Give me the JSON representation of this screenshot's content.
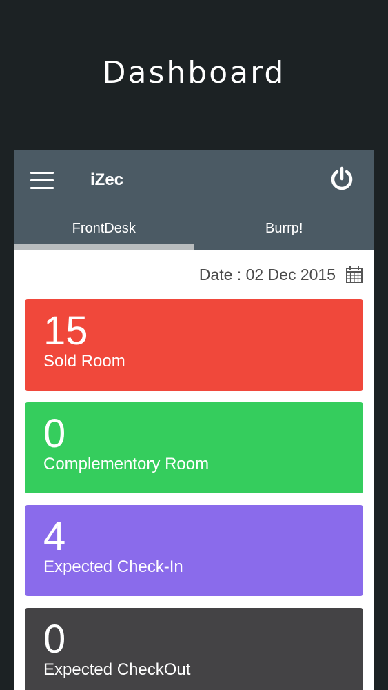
{
  "page": {
    "title": "Dashboard"
  },
  "appbar": {
    "title": "iZec",
    "menu_icon": "hamburger-menu-icon",
    "power_icon": "power-icon",
    "color": "#4b5a64"
  },
  "tabs": [
    {
      "label": "FrontDesk",
      "active": true
    },
    {
      "label": "Burrp!",
      "active": false
    }
  ],
  "date": {
    "text": "Date : 02 Dec 2015",
    "icon": "calendar-icon"
  },
  "cards": [
    {
      "value": "15",
      "label": "Sold Room",
      "color": "#f0483b"
    },
    {
      "value": "0",
      "label": "Complementory Room",
      "color": "#35cd5d"
    },
    {
      "value": "4",
      "label": "Expected Check-In",
      "color": "#8a6beb"
    },
    {
      "value": "0",
      "label": "Expected CheckOut",
      "color": "#444345"
    }
  ]
}
